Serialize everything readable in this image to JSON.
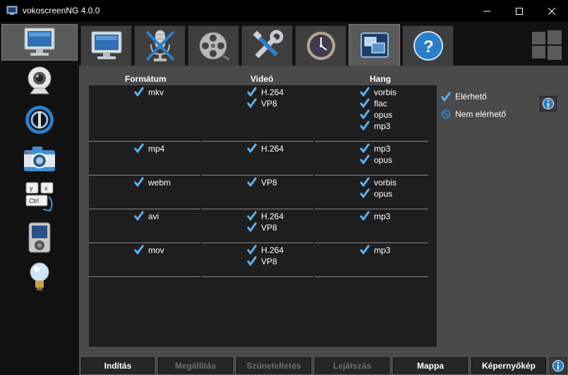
{
  "window": {
    "title": "vokoscreenNG 4.0.0",
    "minimize_label": "–",
    "maximize_label": "☐",
    "close_label": "✕"
  },
  "sidebar": {
    "items": [
      {
        "name": "screencast",
        "icon": "monitor-icon",
        "active": true
      },
      {
        "name": "camera",
        "icon": "webcam-icon",
        "active": false
      },
      {
        "name": "player",
        "icon": "player-icon",
        "active": false
      },
      {
        "name": "snapshot",
        "icon": "camera-icon",
        "active": false
      },
      {
        "name": "showkey",
        "icon": "keyboard-icon",
        "active": false
      },
      {
        "name": "media-player",
        "icon": "media-player-icon",
        "active": false
      },
      {
        "name": "tips",
        "icon": "lightbulb-icon",
        "active": false
      }
    ]
  },
  "tabs": [
    {
      "name": "screen",
      "icon": "monitor-icon",
      "active": false
    },
    {
      "name": "audio",
      "icon": "microphone-muted-icon",
      "active": false
    },
    {
      "name": "video",
      "icon": "film-reel-icon",
      "active": false
    },
    {
      "name": "misc",
      "icon": "tools-icon",
      "active": false
    },
    {
      "name": "timer",
      "icon": "clock-icon",
      "active": false
    },
    {
      "name": "available",
      "icon": "windows-overview-icon",
      "active": true
    },
    {
      "name": "about",
      "icon": "help-icon",
      "active": false
    }
  ],
  "table": {
    "headers": {
      "format": "Formátum",
      "video": "Videó",
      "audio": "Hang"
    },
    "rows": [
      {
        "format": "mkv",
        "video": [
          "H.264",
          "VP8"
        ],
        "audio": [
          "vorbis",
          "flac",
          "opus",
          "mp3"
        ]
      },
      {
        "format": "mp4",
        "video": [
          "H.264"
        ],
        "audio": [
          "mp3",
          "opus"
        ]
      },
      {
        "format": "webm",
        "video": [
          "VP8"
        ],
        "audio": [
          "vorbis",
          "opus"
        ]
      },
      {
        "format": "avi",
        "video": [
          "H.264",
          "VP8"
        ],
        "audio": [
          "mp3"
        ]
      },
      {
        "format": "mov",
        "video": [
          "H.264",
          "VP8"
        ],
        "audio": [
          "mp3"
        ]
      }
    ]
  },
  "legend": {
    "available": "Elérhető",
    "unavailable": "Nem elérhető"
  },
  "buttons": {
    "start": "Indítás",
    "stop": "Megállítás",
    "pause": "Szüneteltetés",
    "play": "Lejátszás",
    "folder": "Mappa",
    "snapshot": "Képernyőkép"
  },
  "colors": {
    "check": "#5ab2f0",
    "accent": "#2a7fc9"
  }
}
